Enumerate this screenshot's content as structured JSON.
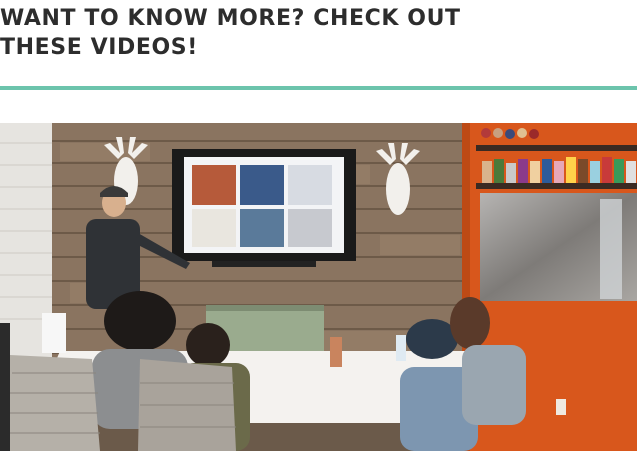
{
  "section": {
    "heading_line1": "WANT TO KNOW MORE? CHECK OUT",
    "heading_line2": "THESE VIDEOS!",
    "accent_color": "#6cc4ac"
  },
  "photo": {
    "icon": "video-thumbnail-photo"
  }
}
